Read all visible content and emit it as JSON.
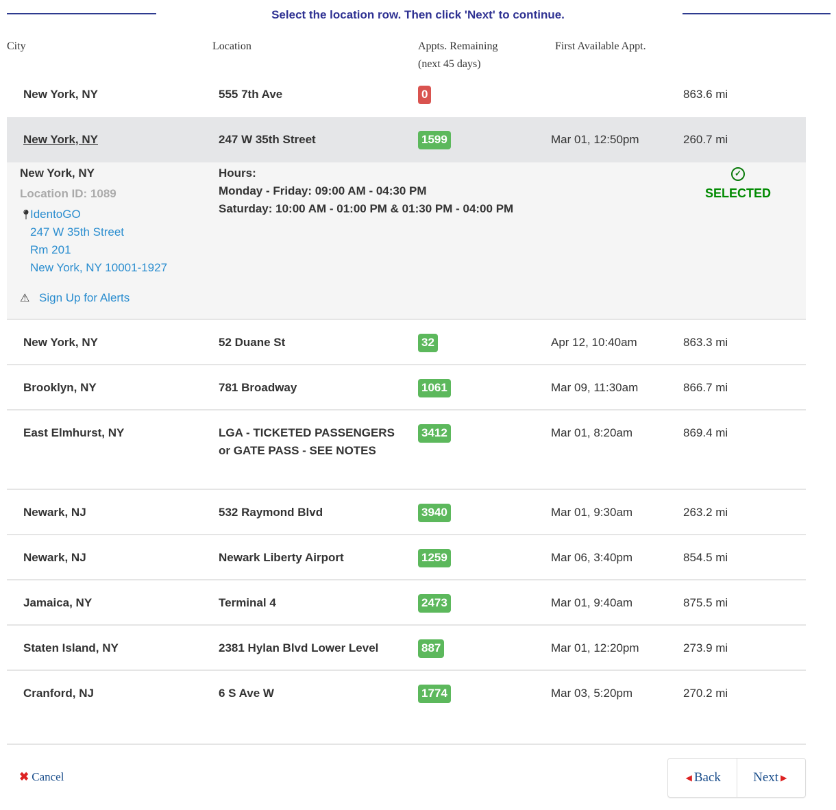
{
  "instruction": "Select the location row. Then click 'Next' to continue.",
  "columns": {
    "city": "City",
    "location": "Location",
    "appts_line1": "Appts. Remaining",
    "appts_line2": "(next 45 days)",
    "first_available": "First Available Appt."
  },
  "rows": [
    {
      "city": "New York, NY",
      "location": "555 7th Ave",
      "appts": "0",
      "appts_status": "none",
      "first": "",
      "distance": "863.6 mi"
    },
    {
      "city": "New York, NY",
      "location": "247 W 35th Street",
      "appts": "1599",
      "appts_status": "available",
      "first": "Mar 01, 12:50pm",
      "distance": "260.7 mi",
      "selected": true
    },
    {
      "city": "New York, NY",
      "location": "52 Duane St",
      "appts": "32",
      "appts_status": "available",
      "first": "Apr 12, 10:40am",
      "distance": "863.3 mi"
    },
    {
      "city": "Brooklyn, NY",
      "location": "781 Broadway",
      "appts": "1061",
      "appts_status": "available",
      "first": "Mar 09, 11:30am",
      "distance": "866.7 mi"
    },
    {
      "city": "East Elmhurst, NY",
      "location": "LGA - TICKETED PASSENGERS or GATE PASS - SEE NOTES",
      "appts": "3412",
      "appts_status": "available",
      "first": "Mar 01, 8:20am",
      "distance": "869.4 mi"
    },
    {
      "city": "Newark, NJ",
      "location": "532 Raymond Blvd",
      "appts": "3940",
      "appts_status": "available",
      "first": "Mar 01, 9:30am",
      "distance": "263.2 mi"
    },
    {
      "city": "Newark, NJ",
      "location": "Newark Liberty Airport",
      "appts": "1259",
      "appts_status": "available",
      "first": "Mar 06, 3:40pm",
      "distance": "854.5 mi"
    },
    {
      "city": "Jamaica, NY",
      "location": "Terminal 4",
      "appts": "2473",
      "appts_status": "available",
      "first": "Mar 01, 9:40am",
      "distance": "875.5 mi"
    },
    {
      "city": "Staten Island, NY",
      "location": "2381 Hylan Blvd Lower Level",
      "appts": "887",
      "appts_status": "available",
      "first": "Mar 01, 12:20pm",
      "distance": "273.9 mi"
    },
    {
      "city": "Cranford, NJ",
      "location": "6 S Ave W",
      "appts": "1774",
      "appts_status": "available",
      "first": "Mar 03, 5:20pm",
      "distance": "270.2 mi"
    }
  ],
  "selected_detail": {
    "city": "New York, NY",
    "location_id": "Location ID: 1089",
    "address": [
      "IdentoGO",
      "247 W 35th Street",
      "Rm 201",
      "New York, NY 10001-1927"
    ],
    "alerts_link": "Sign Up for Alerts",
    "hours_title": "Hours:",
    "hours": [
      "Monday - Friday: 09:00 AM - 04:30 PM",
      "Saturday: 10:00 AM - 01:00 PM & 01:30 PM - 04:00 PM"
    ],
    "selected_label": "SELECTED"
  },
  "footer": {
    "cancel": "Cancel",
    "back": "Back",
    "next": "Next"
  },
  "colors": {
    "instruction": "#2e3192",
    "badge_none": "#d9534f",
    "badge_available": "#5cb85c",
    "link": "#2a8dcf",
    "selected": "#008a00"
  }
}
